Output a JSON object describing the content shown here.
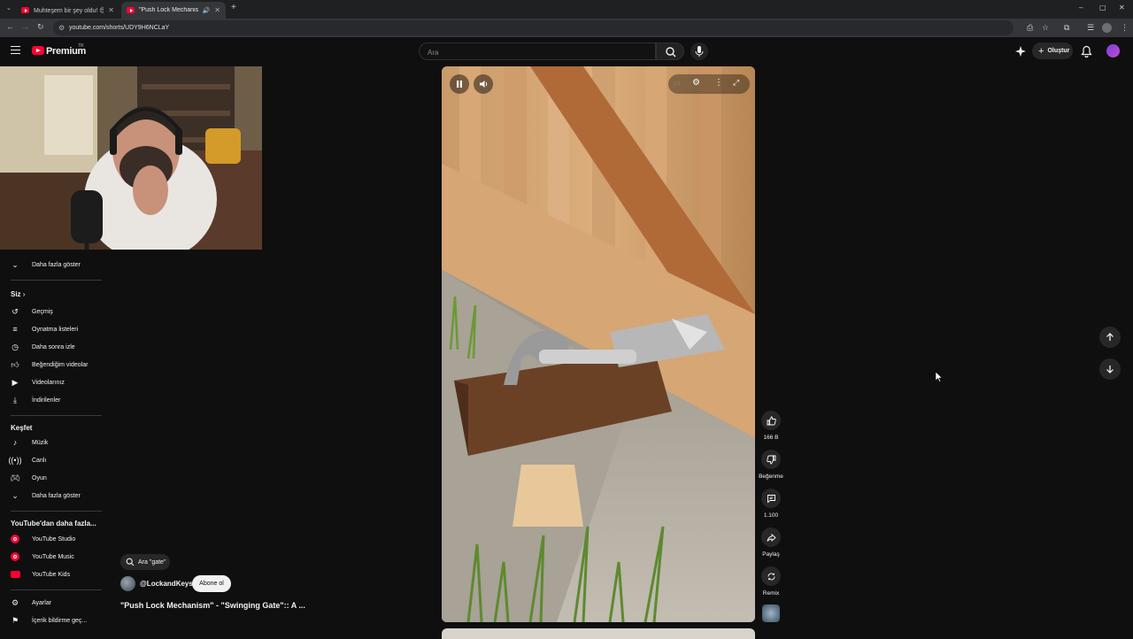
{
  "browser": {
    "tabs": [
      {
        "title": "Muhteşem bir şey oldu! 😍 - Y",
        "active": false
      },
      {
        "title": "\"Push Lock Mechanism\" - \"S",
        "active": true
      }
    ],
    "url": "youtube.com/shorts/UDY9H6NCLaY"
  },
  "header": {
    "logo_text": "Premium",
    "country_code": "TR",
    "search_placeholder": "Ara",
    "create_label": "Oluştur"
  },
  "sidebar": {
    "show_more_top": "Daha fazla göster",
    "you_header": "Siz",
    "you_items": [
      {
        "label": "Geçmiş",
        "icon": "history-icon"
      },
      {
        "label": "Oynatma listeleri",
        "icon": "playlist-icon"
      },
      {
        "label": "Daha sonra izle",
        "icon": "clock-icon"
      },
      {
        "label": "Beğendiğim videolar",
        "icon": "thumbs-up-icon"
      },
      {
        "label": "Videolarınız",
        "icon": "video-icon"
      },
      {
        "label": "İndirilenler",
        "icon": "download-icon"
      }
    ],
    "explore_header": "Keşfet",
    "explore_items": [
      {
        "label": "Müzik",
        "icon": "music-icon"
      },
      {
        "label": "Canlı",
        "icon": "live-icon"
      },
      {
        "label": "Oyun",
        "icon": "gaming-icon"
      },
      {
        "label": "Daha fazla göster",
        "icon": "chevron-down-icon"
      }
    ],
    "more_header": "YouTube'dan daha fazla...",
    "more_items": [
      {
        "label": "YouTube Studio"
      },
      {
        "label": "YouTube Music"
      },
      {
        "label": "YouTube Kids"
      }
    ],
    "settings_items": [
      {
        "label": "Ayarlar",
        "icon": "gear-icon"
      },
      {
        "label": "İçerik bildirme geç...",
        "icon": "flag-icon"
      }
    ]
  },
  "short": {
    "search_chip": "Ara \"gate\"",
    "channel": "@LockandKeys",
    "subscribe_label": "Abone ol",
    "title": "\"Push Lock Mechanism\" - \"Swinging Gate\":: A ..."
  },
  "actions": {
    "likes": "166 B",
    "dislike_label": "Beğenme",
    "comments": "1.100",
    "share_label": "Paylaş",
    "remix_label": "Remix"
  },
  "colors": {
    "brand": "#ff0033",
    "background": "#0f0f0f",
    "chip": "#272727"
  }
}
